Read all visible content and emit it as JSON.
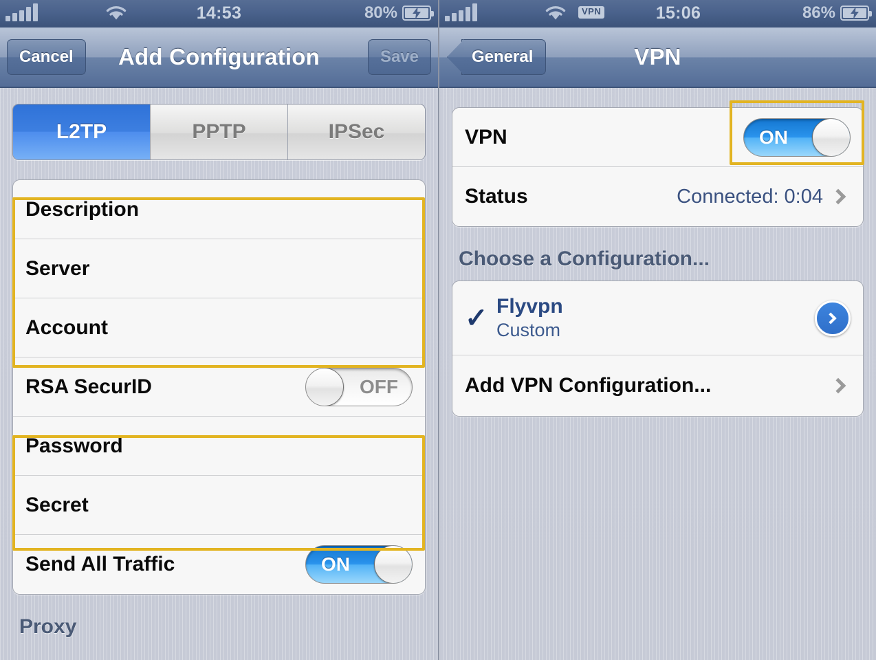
{
  "left": {
    "statusbar": {
      "signal_icon": "signal-bars-icon",
      "wifi_icon": "wifi-icon",
      "time": "14:53",
      "battery_percent": "80%",
      "battery_icon": "battery-charging-icon"
    },
    "navbar": {
      "cancel_label": "Cancel",
      "title": "Add Configuration",
      "save_label": "Save"
    },
    "segmented": {
      "options": [
        "L2TP",
        "PPTP",
        "IPSec"
      ],
      "selected": "L2TP"
    },
    "form_group": [
      {
        "label": "Description",
        "type": "text"
      },
      {
        "label": "Server",
        "type": "text"
      },
      {
        "label": "Account",
        "type": "text"
      },
      {
        "label": "RSA SecurID",
        "type": "toggle",
        "value": "OFF"
      },
      {
        "label": "Password",
        "type": "text"
      },
      {
        "label": "Secret",
        "type": "text"
      },
      {
        "label": "Send All Traffic",
        "type": "toggle",
        "value": "ON"
      }
    ],
    "proxy_header": "Proxy"
  },
  "right": {
    "statusbar": {
      "signal_icon": "signal-bars-icon",
      "wifi_icon": "wifi-icon",
      "vpn_badge": "VPN",
      "time": "15:06",
      "battery_percent": "86%",
      "battery_icon": "battery-charging-icon"
    },
    "navbar": {
      "back_label": "General",
      "title": "VPN"
    },
    "vpn_group": {
      "vpn_label": "VPN",
      "vpn_toggle_value": "ON",
      "status_label": "Status",
      "status_value": "Connected: 0:04",
      "status_chevron": "chevron-right-icon"
    },
    "choose_header": "Choose a Configuration...",
    "configs": [
      {
        "check": "✓",
        "name": "Flyvpn",
        "subtitle": "Custom",
        "disclosure": "detail-disclosure-icon"
      }
    ],
    "add_config_label": "Add VPN Configuration...",
    "add_config_chevron": "chevron-right-icon"
  },
  "annotations": {
    "color": "#e2b422",
    "boxes": [
      {
        "name": "fields-description-server-account"
      },
      {
        "name": "fields-password-secret"
      },
      {
        "name": "vpn-on-toggle"
      }
    ]
  }
}
